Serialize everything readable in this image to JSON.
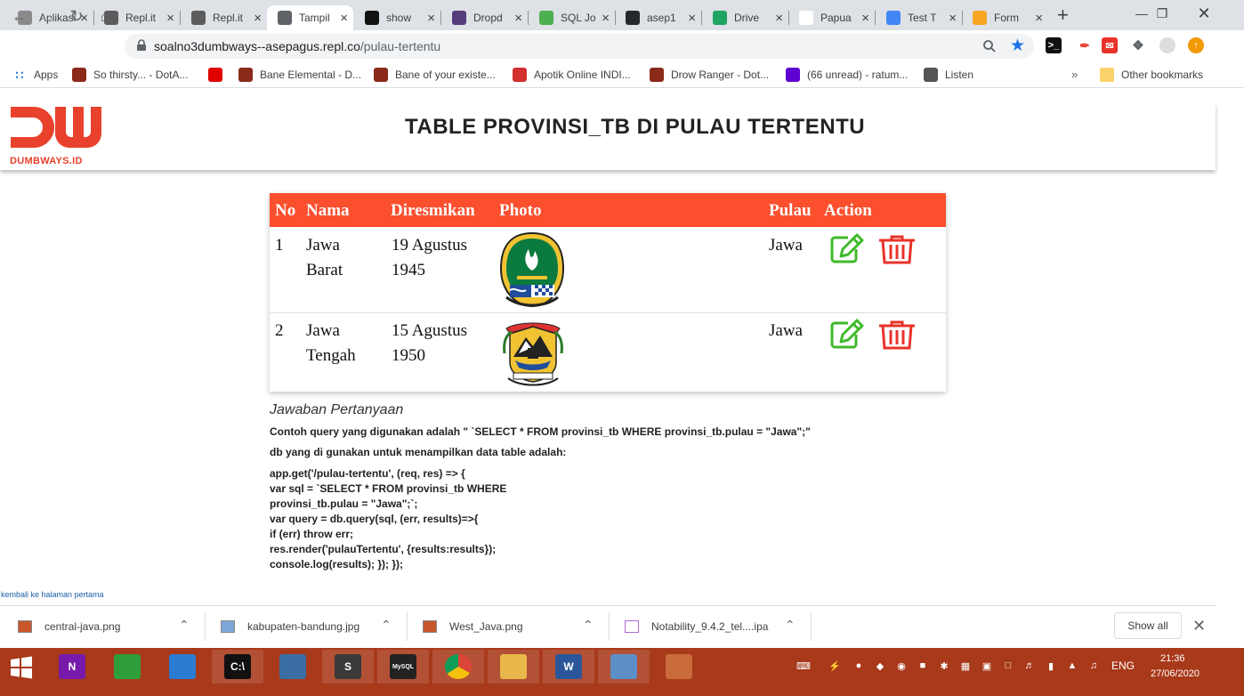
{
  "tabs": [
    {
      "title": "Aplikasi",
      "icon": "chrome-settings-icon",
      "color": "#8a8a8a"
    },
    {
      "title": "Repl.it",
      "icon": "replit-icon",
      "color": "#5c5c5c"
    },
    {
      "title": "Repl.it",
      "icon": "replit-icon",
      "color": "#5c5c5c"
    },
    {
      "title": "Tampil",
      "icon": "globe-icon",
      "color": "#5f6368"
    },
    {
      "title": "show",
      "icon": "terminal-icon",
      "color": "#111111"
    },
    {
      "title": "Dropd",
      "icon": "bootstrap-icon",
      "color": "#563d7c"
    },
    {
      "title": "SQL Jo",
      "icon": "w3schools-icon",
      "color": "#4caf50"
    },
    {
      "title": "asep1",
      "icon": "github-icon",
      "color": "#24292e"
    },
    {
      "title": "Drive",
      "icon": "google-drive-icon",
      "color": "#1fa463"
    },
    {
      "title": "Papua",
      "icon": "wikipedia-icon",
      "color": "#ffffff"
    },
    {
      "title": "Test T",
      "icon": "google-docs-icon",
      "color": "#4285f4"
    },
    {
      "title": "Form",
      "icon": "form-icon",
      "color": "#f6a623"
    }
  ],
  "address_bar": {
    "host": "soalno3dumbways--asepagus.repl.co",
    "path": "/pulau-tertentu"
  },
  "bookmarks": [
    {
      "label": "Apps",
      "icon": "apps-grid-icon"
    },
    {
      "label": "So thirsty... - DotA...",
      "icon": "dota-icon"
    },
    {
      "label": "",
      "icon": "youtube-icon"
    },
    {
      "label": "Bane Elemental - D...",
      "icon": "dota-icon"
    },
    {
      "label": "Bane of your existe...",
      "icon": "dota-icon"
    },
    {
      "label": "Apotik Online INDI...",
      "icon": "apotik-icon"
    },
    {
      "label": "Drow Ranger - Dot...",
      "icon": "dota-icon"
    },
    {
      "label": "(66 unread) - ratum...",
      "icon": "yahoo-icon"
    },
    {
      "label": "Listen",
      "icon": "listen-icon"
    }
  ],
  "other_bookmarks": "Other bookmarks",
  "chevron": "»",
  "page": {
    "logo_text": "DUMBWAYS.ID",
    "title": "TABLE PROVINSI_TB DI PULAU TERTENTU",
    "table": {
      "headers": {
        "no": "No",
        "nama": "Nama",
        "diresmikan": "Diresmikan",
        "photo": "Photo",
        "pulau": "Pulau",
        "action": "Action"
      },
      "rows": [
        {
          "no": "1",
          "nama_1": "Jawa",
          "nama_2": "Barat",
          "date_1": "19 Agustus",
          "date_2": "1945",
          "pulau": "Jawa",
          "photo": "west-java-emblem"
        },
        {
          "no": "2",
          "nama_1": "Jawa",
          "nama_2": "Tengah",
          "date_1": "15 Agustus",
          "date_2": "1950",
          "pulau": "Jawa",
          "photo": "central-java-emblem"
        }
      ],
      "colors": {
        "header_bg": "#fb4f2e",
        "edit": "#3fb92a",
        "delete": "#e8332a"
      }
    },
    "answer": {
      "heading": "Jawaban Pertanyaan",
      "line1": "Contoh query yang digunakan adalah \" `SELECT * FROM provinsi_tb WHERE provinsi_tb.pulau = \"Jawa\";\"",
      "line2": "db yang di gunakan untuk menampilkan data table adalah:",
      "code": [
        "app.get('/pulau-tertentu', (req, res) => {",
        "var sql = `SELECT * FROM provinsi_tb WHERE",
        "provinsi_tb.pulau = \"Jawa\";`;",
        "var query = db.query(sql, (err, results)=>{",
        "if (err) throw err;",
        "res.render('pulauTertentu', {results:results});",
        "console.log(results); }); });"
      ]
    },
    "back_link": "kembali ke halaman pertama"
  },
  "downloads": [
    {
      "name": "central-java.png"
    },
    {
      "name": "kabupaten-bandung.jpg"
    },
    {
      "name": "West_Java.png"
    },
    {
      "name": "Notability_9.4.2_tel....ipa"
    }
  ],
  "show_all": "Show all",
  "taskbar": {
    "apps": [
      {
        "icon": "onenote-icon",
        "label": "N",
        "color": "#7719aa"
      },
      {
        "icon": "store-icon",
        "label": "",
        "color": "#2e9e3a"
      },
      {
        "icon": "network-globe-icon",
        "label": "",
        "color": "#2a7bd1"
      },
      {
        "icon": "cmd-icon",
        "label": "C:\\",
        "color": "#111111"
      },
      {
        "icon": "pc-icon",
        "label": "",
        "color": "#3b6ea5"
      },
      {
        "icon": "sublime-icon",
        "label": "S",
        "color": "#3a3a3a"
      },
      {
        "icon": "mysql-icon",
        "label": "MySQL",
        "color": "#222222"
      },
      {
        "icon": "chrome-icon",
        "label": "",
        "color": "#e3a21a"
      },
      {
        "icon": "explorer-icon",
        "label": "",
        "color": "#e8b84a"
      },
      {
        "icon": "word-icon",
        "label": "W",
        "color": "#2b579a"
      },
      {
        "icon": "photos-icon",
        "label": "",
        "color": "#5c8fc8"
      },
      {
        "icon": "paint-icon",
        "label": "",
        "color": "#c96b3a"
      }
    ],
    "lang": "ENG",
    "time": "21:36",
    "date": "27/06/2020",
    "color": "#a8391a"
  }
}
